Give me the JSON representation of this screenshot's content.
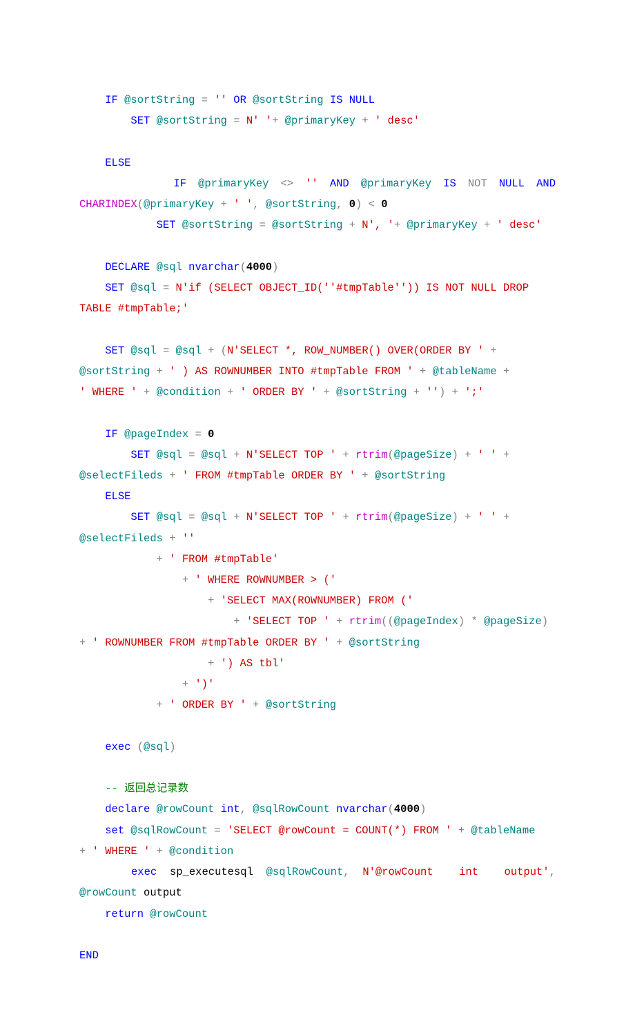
{
  "code": {
    "l01a": "    IF",
    "l01b": " @sortString ",
    "l01c": "=",
    "l01d": " '' ",
    "l01e": "OR",
    "l01f": " @sortString ",
    "l01g": "IS NULL",
    "l02a": "        SET",
    "l02b": " @sortString ",
    "l02c": "=",
    "l02d": " N' '",
    "l02e": "+",
    "l02f": " @primaryKey ",
    "l02g": "+",
    "l02h": " ' desc'",
    "l04a": "    ELSE",
    "l05a": "        IF",
    "l05b": "@primaryKey",
    "l05c": "<>",
    "l05d": "''",
    "l05e": "AND",
    "l05f": "@primaryKey",
    "l05g": "IS",
    "l05h": "NOT",
    "l05i": "NULL",
    "l05j": "AND",
    "l06a": "CHARINDEX",
    "l06b": "(",
    "l06c": "@primaryKey ",
    "l06d": "+",
    "l06e": " ' '",
    "l06f": ",",
    "l06g": " @sortString",
    "l06h": ",",
    "l06i": " 0",
    "l06j": ")",
    "l06k": " <",
    "l06l": " 0",
    "l07a": "            SET",
    "l07b": " @sortString ",
    "l07c": "=",
    "l07d": " @sortString ",
    "l07e": "+",
    "l07f": " N', '",
    "l07g": "+",
    "l07h": " @primaryKey ",
    "l07i": "+",
    "l07j": " ' desc'",
    "l09a": "    DECLARE",
    "l09b": " @sql ",
    "l09c": "nvarchar",
    "l09d": "(",
    "l09e": "4000",
    "l09f": ")",
    "l10a": "    SET",
    "l10b": " @sql ",
    "l10c": "=",
    "l10d": " N'if (SELECT OBJECT_ID(''#tmpTable'')) IS NOT NULL DROP ",
    "l11a": "TABLE #tmpTable;'",
    "l13a": "    SET",
    "l13b": " @sql ",
    "l13c": "=",
    "l13d": " @sql ",
    "l13e": "+",
    "l13f": " (",
    "l13g": "N'SELECT *, ROW_NUMBER() OVER(ORDER BY '",
    "l13h": " +",
    "l14a": "@sortString ",
    "l14b": "+",
    "l14c": " ' ) AS ROWNUMBER INTO #tmpTable FROM '",
    "l14d": " +",
    "l14e": " @tableName ",
    "l14f": "+",
    "l15a": "' WHERE '",
    "l15b": " +",
    "l15c": " @condition ",
    "l15d": "+",
    "l15e": " ' ORDER BY '",
    "l15f": " +",
    "l15g": " @sortString ",
    "l15h": "+",
    "l15i": " ''",
    "l15j": ")",
    "l15k": " +",
    "l15l": " ';'",
    "l17a": "    IF",
    "l17b": " @pageIndex ",
    "l17c": "=",
    "l17d": " 0",
    "l18a": "        SET",
    "l18b": " @sql ",
    "l18c": "=",
    "l18d": " @sql ",
    "l18e": "+",
    "l18f": " N'SELECT TOP '",
    "l18g": " +",
    "l18h": " rtrim",
    "l18i": "(",
    "l18j": "@pageSize",
    "l18k": ")",
    "l18l": " +",
    "l18m": " ' '",
    "l18n": " +",
    "l19a": "@selectFileds ",
    "l19b": "+",
    "l19c": " ' FROM #tmpTable ORDER BY '",
    "l19d": " +",
    "l19e": " @sortString",
    "l20a": "    ELSE",
    "l21a": "        SET",
    "l21b": " @sql ",
    "l21c": "=",
    "l21d": " @sql ",
    "l21e": "+",
    "l21f": " N'SELECT TOP '",
    "l21g": " +",
    "l21h": " rtrim",
    "l21i": "(",
    "l21j": "@pageSize",
    "l21k": ")",
    "l21l": " +",
    "l21m": " ' '",
    "l21n": " +",
    "l22a": "@selectFileds ",
    "l22b": "+",
    "l22c": " ''",
    "l23a": "            +",
    "l23b": " ' FROM #tmpTable'",
    "l24a": "                +",
    "l24b": " ' WHERE ROWNUMBER > ('",
    "l25a": "                    +",
    "l25b": " 'SELECT MAX(ROWNUMBER) FROM ('",
    "l26a": "                        +",
    "l26b": " 'SELECT TOP '",
    "l26c": " +",
    "l26d": " rtrim",
    "l26e": "((",
    "l26f": "@pageIndex",
    "l26g": ")",
    "l26h": " *",
    "l26i": " @pageSize",
    "l26j": ")",
    "l27a": "+",
    "l27b": " ' ROWNUMBER FROM #tmpTable ORDER BY '",
    "l27c": " +",
    "l27d": " @sortString",
    "l28a": "                    +",
    "l28b": " ') AS tbl'",
    "l29a": "                +",
    "l29b": " ')'",
    "l30a": "            +",
    "l30b": " ' ORDER BY '",
    "l30c": " +",
    "l30d": " @sortString",
    "l32a": "    exec",
    "l32b": " (",
    "l32c": "@sql",
    "l32d": ")",
    "l34a": "    -- 返回总记录数",
    "l35a": "    declare",
    "l35b": " @rowCount ",
    "l35c": "int",
    "l35d": ",",
    "l35e": " @sqlRowCount ",
    "l35f": "nvarchar",
    "l35g": "(",
    "l35h": "4000",
    "l35i": ")",
    "l36a": "    set",
    "l36b": " @sqlRowCount ",
    "l36c": "=",
    "l36d": " 'SELECT @rowCount = COUNT(*) FROM '",
    "l36e": " +",
    "l36f": " @tableName",
    "l37a": "+",
    "l37b": " ' WHERE '",
    "l37c": " +",
    "l37d": " @condition",
    "l38a": "    exec",
    "l38b": "sp_executesql",
    "l38c": "@sqlRowCount",
    "l38d": ",",
    "l38e": "N'@rowCount  int  output'",
    "l38f": ",",
    "l39a": "@rowCount ",
    "l39b": "output",
    "l40a": "    return",
    "l40b": " @rowCount",
    "l42a": "END"
  }
}
